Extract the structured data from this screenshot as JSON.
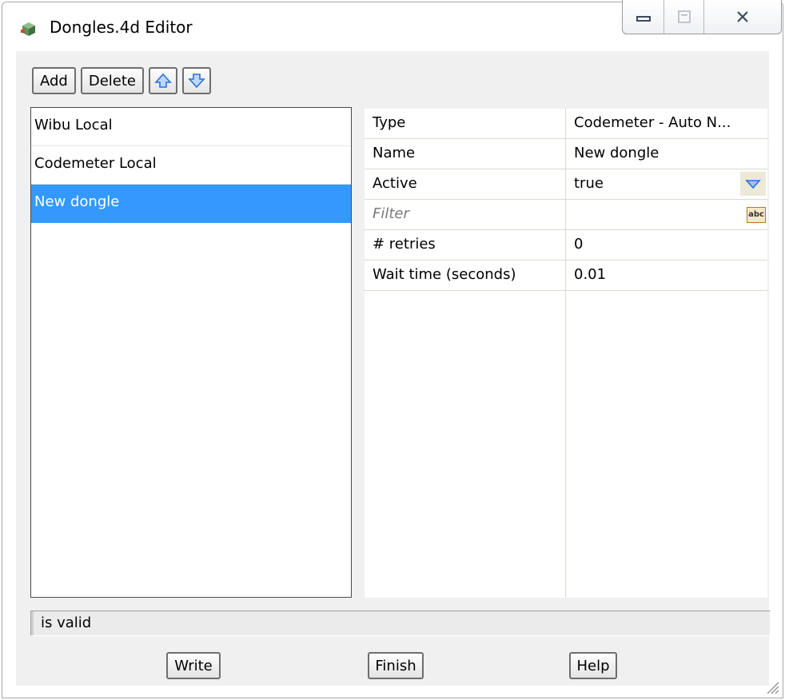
{
  "window": {
    "title": "Dongles.4d Editor"
  },
  "toolbar": {
    "add_label": "Add",
    "delete_label": "Delete"
  },
  "list": {
    "items": [
      {
        "label": "Wibu Local"
      },
      {
        "label": "Codemeter Local"
      },
      {
        "label": "New dongle",
        "selected": true
      }
    ]
  },
  "properties": {
    "rows": [
      {
        "key": "Type",
        "value": "Codemeter - Auto N..."
      },
      {
        "key": "Name",
        "value": "New dongle"
      },
      {
        "key": "Active",
        "value": "true"
      },
      {
        "key": "Filter",
        "value": ""
      },
      {
        "key": "# retries",
        "value": "0"
      },
      {
        "key": "Wait time (seconds)",
        "value": "0.01"
      }
    ],
    "abc_label": "abc"
  },
  "status": {
    "text": "is valid"
  },
  "buttons": {
    "write_label": "Write",
    "finish_label": "Finish",
    "help_label": "Help"
  },
  "colors": {
    "selection": "#3399ff",
    "arrow_blue": "#2f6fd6"
  }
}
